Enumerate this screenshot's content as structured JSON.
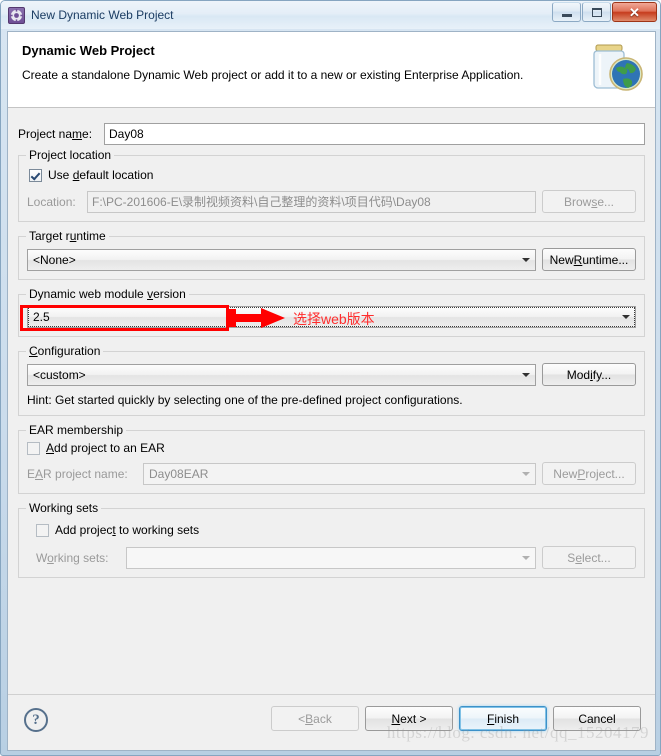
{
  "window": {
    "title": "New Dynamic Web Project",
    "icon": "gear-icon",
    "minimize_label": "Minimize",
    "maximize_label": "Maximize",
    "close_label": "✕"
  },
  "banner": {
    "title": "Dynamic Web Project",
    "description": "Create a standalone Dynamic Web project or add it to a new or existing Enterprise Application.",
    "image": "jar-globe-icon"
  },
  "project_name": {
    "label_pre": "Project na",
    "label_mnemonic": "m",
    "label_post": "e:",
    "value": "Day08"
  },
  "project_location": {
    "caption": "Project location",
    "use_default": {
      "label_pre": "Use ",
      "label_mnemonic": "d",
      "label_post": "efault location",
      "checked": true
    },
    "location_label": "Location:",
    "location_value": "F:\\PC-201606-E\\录制视频资料\\自己整理的资料\\项目代码\\Day08",
    "browse_pre": "Brow",
    "browse_mnemonic": "s",
    "browse_post": "e..."
  },
  "target_runtime": {
    "caption_pre": "Target r",
    "caption_mnemonic": "u",
    "caption_post": "ntime",
    "value": "<None>",
    "new_runtime_pre": "New ",
    "new_runtime_mnemonic": "R",
    "new_runtime_post": "untime..."
  },
  "module_version": {
    "caption_pre": "Dynamic web module ",
    "caption_mnemonic": "v",
    "caption_post": "ersion",
    "value": "2.5"
  },
  "configuration": {
    "caption_mnemonic": "C",
    "caption_post": "onfiguration",
    "value": "<custom>",
    "modify_pre": "Mod",
    "modify_mnemonic": "i",
    "modify_post": "fy...",
    "hint": "Hint: Get started quickly by selecting one of the pre-defined project configurations."
  },
  "ear_membership": {
    "caption": "EAR membership",
    "add_to_ear": {
      "label_mnemonic": "A",
      "label_post": "dd project to an EAR",
      "checked": false
    },
    "ear_project_label_pre": "E",
    "ear_project_label_mnemonic": "A",
    "ear_project_label_post": "R project name:",
    "ear_project_value": "Day08EAR",
    "new_project_pre": "New ",
    "new_project_mnemonic": "P",
    "new_project_post": "roject..."
  },
  "working_sets": {
    "caption": "Working sets",
    "add_to_working_sets": {
      "label_pre": "Add projec",
      "label_mnemonic": "t",
      "label_post": " to working sets",
      "checked": false
    },
    "working_sets_label_pre": "W",
    "working_sets_label_mnemonic": "o",
    "working_sets_label_post": "rking sets:",
    "working_sets_value": "",
    "select_pre": "S",
    "select_mnemonic": "e",
    "select_post": "lect..."
  },
  "footer": {
    "help": "?",
    "back_pre": "< ",
    "back_mnemonic": "B",
    "back_post": "ack",
    "next_pre": "",
    "next_mnemonic": "N",
    "next_post": "ext >",
    "finish_mnemonic": "F",
    "finish_post": "inish",
    "cancel": "Cancel"
  },
  "annotation": {
    "text": "选择web版本",
    "color": "#ff0000"
  },
  "watermark": "https://blog. csdn. net/qq_15204179"
}
